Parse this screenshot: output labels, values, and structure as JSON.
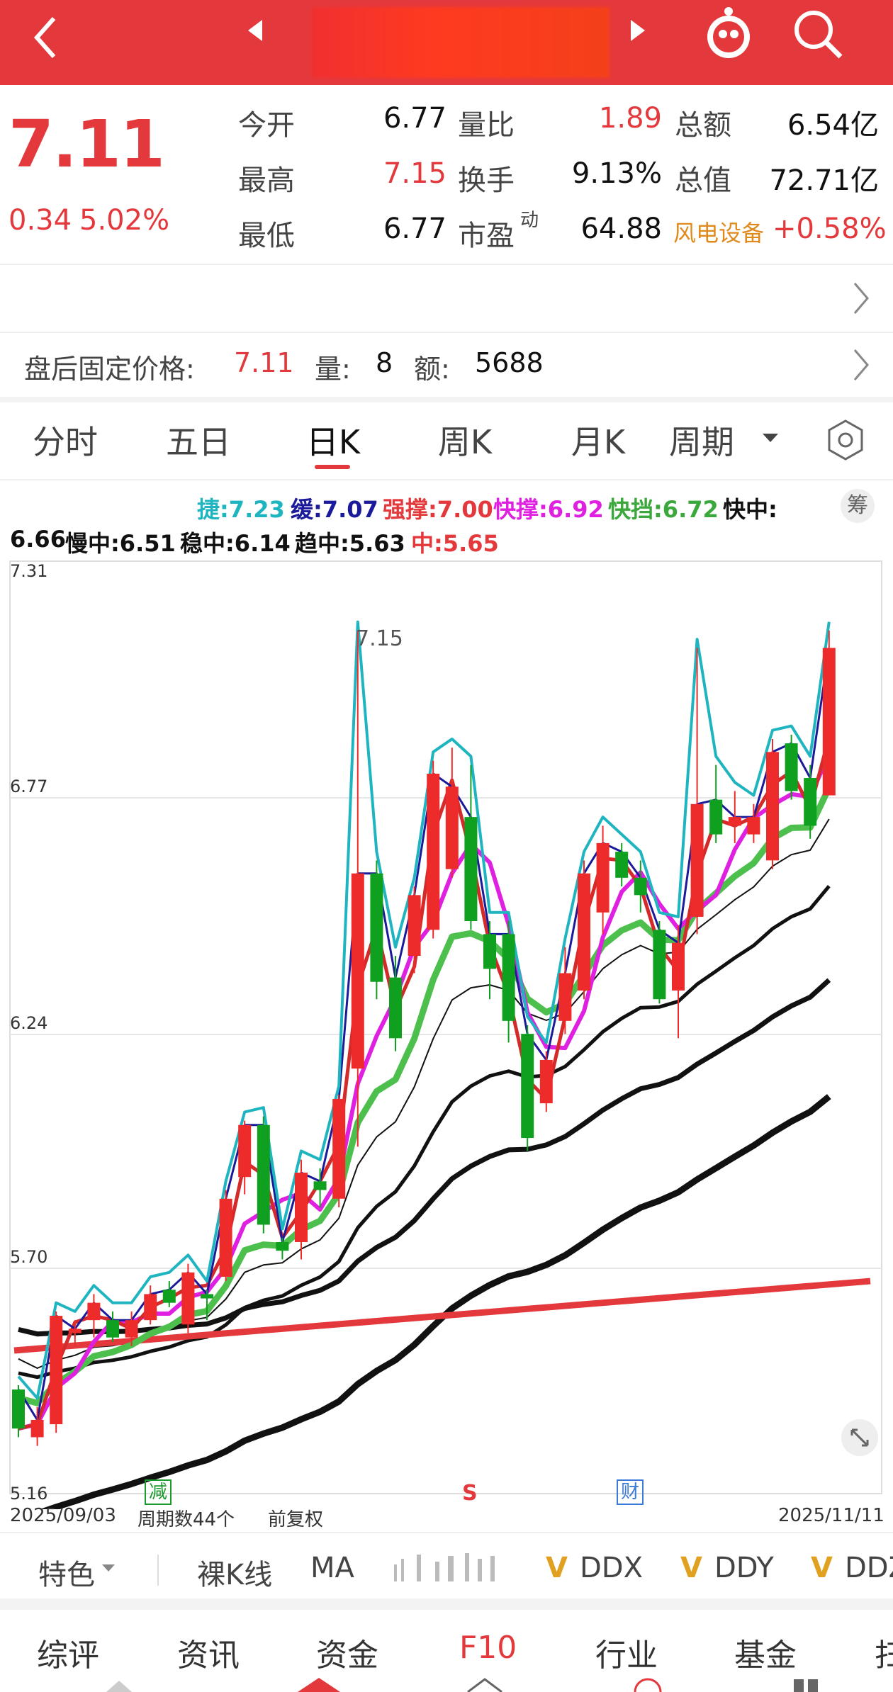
{
  "header": {
    "back": "back-icon",
    "prev": "prev-stock-icon",
    "next": "next-stock-icon",
    "mascot": "mascot-icon",
    "search": "search-icon"
  },
  "quote": {
    "price": "7.11",
    "change": "0.34",
    "change_pct": "5.02%",
    "stats": [
      {
        "label": "今开",
        "value": "6.77"
      },
      {
        "label": "量比",
        "value": "1.89"
      },
      {
        "label": "总额",
        "value": "6.54亿"
      },
      {
        "label": "最高",
        "value": "7.15"
      },
      {
        "label": "换手",
        "value": "9.13%"
      },
      {
        "label": "总值",
        "value": "72.71亿"
      },
      {
        "label": "最低",
        "value": "6.77"
      },
      {
        "label": "市盈",
        "value": "64.88",
        "sup": "动"
      },
      {
        "label": "风电设备",
        "value": "+0.58%"
      }
    ]
  },
  "after_hours": {
    "label": "盘后固定价格:",
    "price": "7.11",
    "vol_label": "量:",
    "vol": "8",
    "amt_label": "额:",
    "amt": "5688"
  },
  "tabs": [
    "分时",
    "五日",
    "日K",
    "周K",
    "月K",
    "周期"
  ],
  "active_tab": 2,
  "indicators_line1": [
    {
      "text": "捷:7.23",
      "color": "#1fb5c0"
    },
    {
      "text": "缓:7.07",
      "color": "#1a1a9a"
    },
    {
      "text": "强撑:7.00",
      "color": "#e4393c"
    },
    {
      "text": "快撑:6.92",
      "color": "#e020e0"
    },
    {
      "text": "快挡:6.72",
      "color": "#3aa83a"
    },
    {
      "text": "快中:",
      "color": "#111"
    }
  ],
  "indicators_line2": [
    {
      "text": "6.66",
      "color": "#111"
    },
    {
      "text": "慢中:6.51",
      "color": "#111"
    },
    {
      "text": "稳中:6.14",
      "color": "#111"
    },
    {
      "text": "趋中:5.63",
      "color": "#111"
    },
    {
      "text": "中:5.65",
      "color": "#e4393c"
    }
  ],
  "chip_button": "筹",
  "chart_data": {
    "type": "candlestick",
    "y_ticks": [
      "7.31",
      "6.77",
      "6.24",
      "5.70",
      "5.16"
    ],
    "ylim": [
      5.16,
      7.31
    ],
    "high_mark": "7.15",
    "markers": [
      "减",
      "S",
      "财"
    ],
    "start_date": "2025/09/03",
    "end_date": "2025/11/11",
    "period_count": "周期数44个",
    "adjust": "前复权",
    "candles": [
      [
        5.4,
        5.31,
        5.41,
        5.29
      ],
      [
        5.29,
        5.33,
        5.36,
        5.27
      ],
      [
        5.32,
        5.57,
        5.58,
        5.3
      ],
      [
        5.53,
        5.54,
        5.56,
        5.5
      ],
      [
        5.56,
        5.6,
        5.62,
        5.52
      ],
      [
        5.56,
        5.52,
        5.58,
        5.51
      ],
      [
        5.52,
        5.56,
        5.58,
        5.5
      ],
      [
        5.56,
        5.62,
        5.64,
        5.55
      ],
      [
        5.63,
        5.6,
        5.65,
        5.59
      ],
      [
        5.55,
        5.67,
        5.69,
        5.53
      ],
      [
        5.62,
        5.61,
        5.63,
        5.56
      ],
      [
        5.66,
        5.84,
        5.86,
        5.65
      ],
      [
        5.89,
        6.01,
        6.02,
        5.85
      ],
      [
        6.01,
        5.78,
        6.03,
        5.76
      ],
      [
        5.74,
        5.72,
        5.75,
        5.7
      ],
      [
        5.74,
        5.9,
        5.93,
        5.7
      ],
      [
        5.88,
        5.86,
        5.91,
        5.82
      ],
      [
        5.84,
        6.07,
        6.08,
        5.82
      ],
      [
        6.14,
        6.59,
        7.15,
        5.96
      ],
      [
        6.59,
        6.34,
        6.62,
        6.3
      ],
      [
        6.35,
        6.21,
        6.4,
        6.18
      ],
      [
        6.4,
        6.54,
        6.56,
        6.36
      ],
      [
        6.46,
        6.82,
        6.85,
        6.44
      ],
      [
        6.6,
        6.79,
        6.88,
        6.58
      ],
      [
        6.72,
        6.48,
        6.84,
        6.46
      ],
      [
        6.45,
        6.37,
        6.48,
        6.3
      ],
      [
        6.45,
        6.25,
        6.48,
        6.2
      ],
      [
        6.22,
        5.98,
        6.24,
        5.95
      ],
      [
        6.06,
        6.16,
        6.18,
        6.04
      ],
      [
        6.25,
        6.36,
        6.42,
        6.22
      ],
      [
        6.32,
        6.59,
        6.62,
        6.3
      ],
      [
        6.5,
        6.66,
        6.7,
        6.45
      ],
      [
        6.64,
        6.58,
        6.66,
        6.56
      ],
      [
        6.58,
        6.54,
        6.62,
        6.5
      ],
      [
        6.46,
        6.3,
        6.48,
        6.29
      ],
      [
        6.32,
        6.43,
        6.47,
        6.21
      ],
      [
        6.49,
        6.75,
        7.11,
        6.45
      ],
      [
        6.76,
        6.68,
        6.84,
        6.66
      ],
      [
        6.7,
        6.72,
        6.78,
        6.66
      ],
      [
        6.68,
        6.72,
        6.75,
        6.66
      ],
      [
        6.62,
        6.87,
        6.9,
        6.6
      ],
      [
        6.89,
        6.78,
        6.91,
        6.76
      ],
      [
        6.81,
        6.7,
        6.84,
        6.67
      ],
      [
        6.77,
        7.11,
        7.15,
        6.77
      ]
    ]
  },
  "toolbar": [
    "特色",
    "裸K线",
    "MA",
    "DDX",
    "DDY",
    "DDZ"
  ],
  "bottom_tabs": [
    "综评",
    "资讯",
    "资金",
    "F10",
    "行业",
    "基金",
    "扫"
  ]
}
